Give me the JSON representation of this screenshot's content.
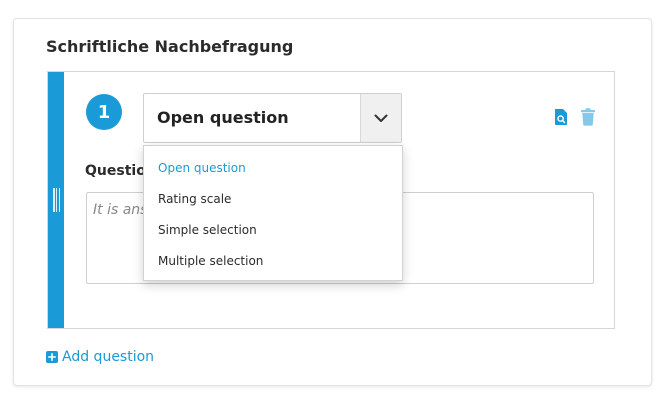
{
  "section": {
    "title": "Schriftliche Nachbefragung"
  },
  "question": {
    "number": "1",
    "type_select": {
      "value": "Open question",
      "options": [
        {
          "label": "Open question",
          "selected": true
        },
        {
          "label": "Rating scale",
          "selected": false
        },
        {
          "label": "Simple selection",
          "selected": false
        },
        {
          "label": "Multiple selection",
          "selected": false
        }
      ]
    },
    "label": "Question",
    "answer_placeholder": "It is answered in a free text field."
  },
  "actions": {
    "add_question": "Add question"
  },
  "colors": {
    "accent": "#1a9ad6",
    "icon_preview": "#1a9ad6",
    "icon_delete": "#86c8ea"
  },
  "icons": {
    "drag": "grip-icon",
    "dropdown": "chevron-down-icon",
    "preview": "document-search-icon",
    "delete": "trash-icon",
    "add": "plus-square-icon"
  }
}
